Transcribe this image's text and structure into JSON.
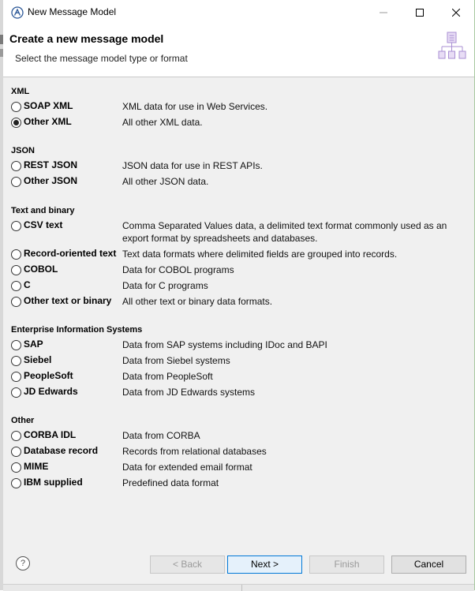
{
  "window": {
    "title": "New Message Model",
    "buttons": [
      "minimize",
      "maximize",
      "close"
    ]
  },
  "banner": {
    "title": "Create a new message model",
    "subtitle": "Select the message model type or format",
    "icon": "message-model-icon"
  },
  "groups": [
    {
      "title": "XML",
      "options": [
        {
          "label": "SOAP XML",
          "description": "XML data for use in Web Services.",
          "selected": false
        },
        {
          "label": "Other XML",
          "description": "All other XML data.",
          "selected": true
        }
      ]
    },
    {
      "title": "JSON",
      "options": [
        {
          "label": "REST JSON",
          "description": "JSON data for use in REST APIs.",
          "selected": false
        },
        {
          "label": "Other JSON",
          "description": "All other JSON data.",
          "selected": false
        }
      ]
    },
    {
      "title": "Text and binary",
      "options": [
        {
          "label": "CSV text",
          "description": "Comma Separated Values data, a delimited text format commonly used as an export format by spreadsheets and databases.",
          "selected": false
        },
        {
          "label": "Record-oriented text",
          "description": "Text data formats where delimited fields are grouped into records.",
          "selected": false
        },
        {
          "label": "COBOL",
          "description": "Data for COBOL programs",
          "selected": false
        },
        {
          "label": "C",
          "description": "Data for C programs",
          "selected": false
        },
        {
          "label": "Other text or binary",
          "description": "All other text or binary data formats.",
          "selected": false
        }
      ]
    },
    {
      "title": "Enterprise Information Systems",
      "options": [
        {
          "label": "SAP",
          "description": "Data from SAP systems including IDoc and BAPI",
          "selected": false
        },
        {
          "label": "Siebel",
          "description": "Data from Siebel systems",
          "selected": false
        },
        {
          "label": "PeopleSoft",
          "description": "Data from PeopleSoft",
          "selected": false
        },
        {
          "label": "JD Edwards",
          "description": "Data from JD Edwards systems",
          "selected": false
        }
      ]
    },
    {
      "title": "Other",
      "options": [
        {
          "label": "CORBA IDL",
          "description": "Data from CORBA",
          "selected": false
        },
        {
          "label": "Database record",
          "description": "Records from relational databases",
          "selected": false
        },
        {
          "label": "MIME",
          "description": "Data for extended email format",
          "selected": false
        },
        {
          "label": "IBM supplied",
          "description": "Predefined data format",
          "selected": false
        }
      ]
    }
  ],
  "footer": {
    "help_icon": "?",
    "back_label": "< Back",
    "next_label": "Next >",
    "finish_label": "Finish",
    "cancel_label": "Cancel"
  },
  "colors": {
    "content_bg": "#f0f0f0",
    "default_button_border": "#0078d7"
  }
}
